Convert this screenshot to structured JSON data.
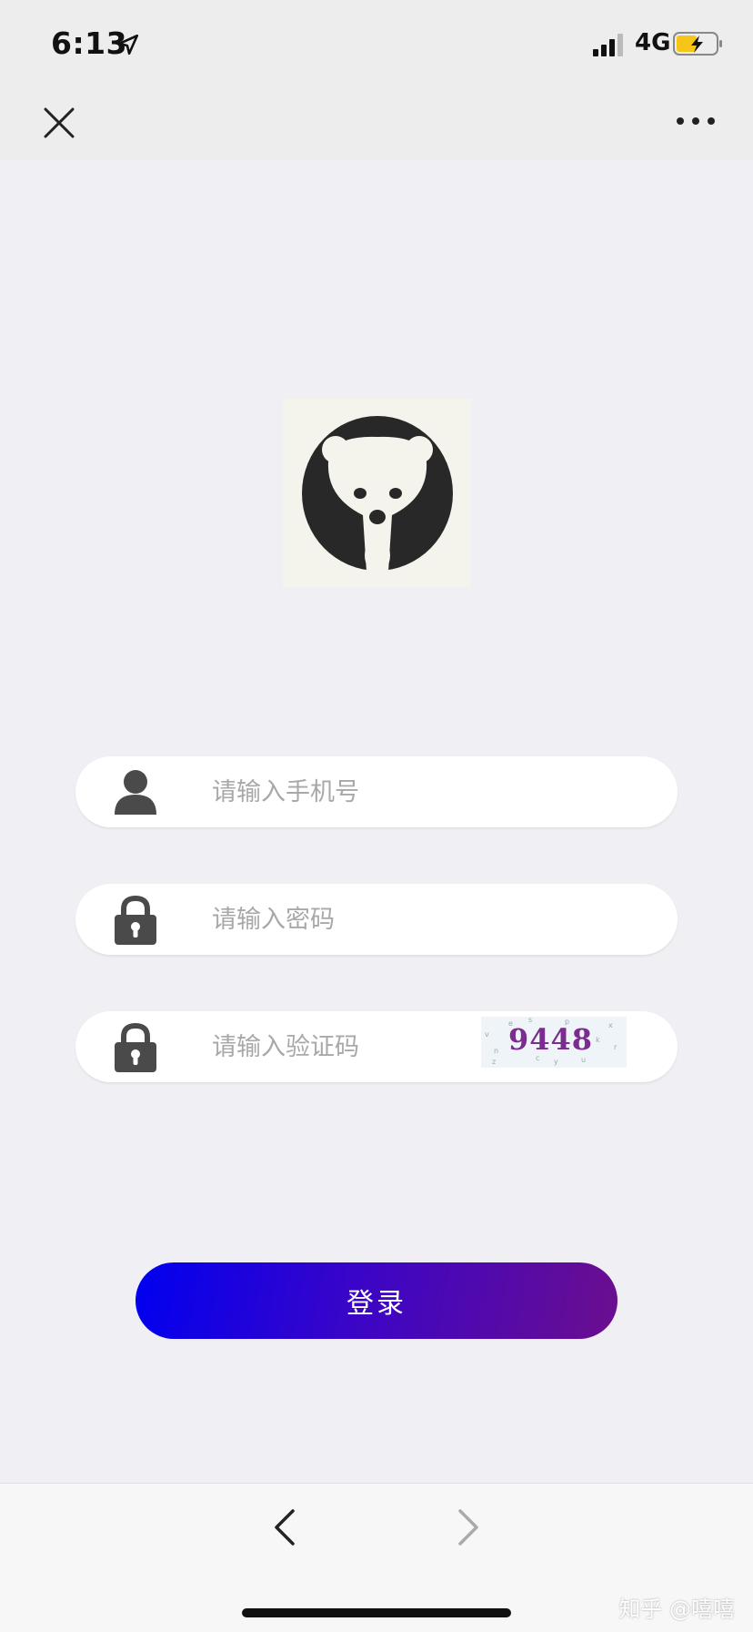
{
  "status_bar": {
    "time": "6:13",
    "network": "4G",
    "icons": [
      "location-arrow-icon",
      "signal-bars-icon",
      "battery-charging-icon"
    ]
  },
  "nav_bar": {
    "close_icon": "close-icon",
    "more_icon": "more-dots-icon"
  },
  "logo": {
    "icon": "bear-logo"
  },
  "form": {
    "phone": {
      "placeholder": "请输入手机号",
      "value": "",
      "icon": "user-icon"
    },
    "password": {
      "placeholder": "请输入密码",
      "value": "",
      "icon": "lock-icon"
    },
    "captcha": {
      "placeholder": "请输入验证码",
      "value": "",
      "icon": "lock-icon",
      "image_text": "9448"
    }
  },
  "login_button": {
    "label": "登录"
  },
  "bottom_bar": {
    "back_icon": "chevron-left-icon",
    "forward_icon": "chevron-right-icon",
    "watermark": "知乎 @嘻嘻"
  },
  "colors": {
    "background": "#efeff4",
    "bar": "#ededed",
    "button_gradient_start": "#0000f0",
    "button_gradient_end": "#6b0e8e",
    "captcha_text": "#7a2d8f",
    "battery_fill": "#f5c518"
  }
}
